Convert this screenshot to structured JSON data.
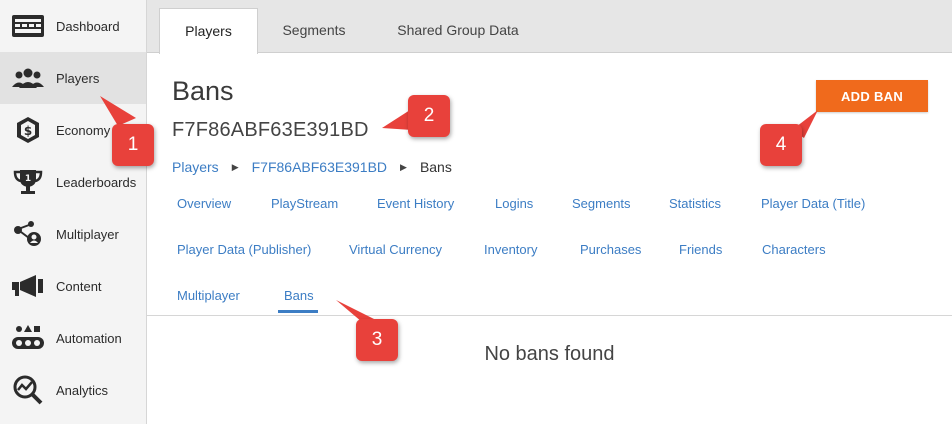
{
  "sidebar": {
    "items": [
      {
        "label": "Dashboard",
        "icon": "dashboard-icon"
      },
      {
        "label": "Players",
        "icon": "players-icon",
        "active": true
      },
      {
        "label": "Economy",
        "icon": "economy-icon"
      },
      {
        "label": "Leaderboards",
        "icon": "trophy-icon"
      },
      {
        "label": "Multiplayer",
        "icon": "multiplayer-icon"
      },
      {
        "label": "Content",
        "icon": "megaphone-icon"
      },
      {
        "label": "Automation",
        "icon": "automation-icon"
      },
      {
        "label": "Analytics",
        "icon": "analytics-icon"
      }
    ]
  },
  "top_tabs": [
    {
      "label": "Players",
      "active": true
    },
    {
      "label": "Segments"
    },
    {
      "label": "Shared Group Data"
    }
  ],
  "page": {
    "title": "Bans",
    "player_id": "F7F86ABF63E391BD",
    "add_ban_label": "ADD BAN",
    "empty_message": "No bans found"
  },
  "breadcrumb": {
    "root": "Players",
    "player": "F7F86ABF63E391BD",
    "current": "Bans"
  },
  "sub_tabs": [
    "Overview",
    "PlayStream",
    "Event History",
    "Logins",
    "Segments",
    "Statistics",
    "Player Data (Title)",
    "Player Data (Publisher)",
    "Virtual Currency",
    "Inventory",
    "Purchases",
    "Friends",
    "Characters",
    "Multiplayer",
    "Bans"
  ],
  "active_sub_tab": "Bans",
  "callouts": [
    "1",
    "2",
    "3",
    "4"
  ],
  "colors": {
    "accent_orange": "#f06a1c",
    "link_blue": "#3c7dc4",
    "callout_red": "#e8413b"
  }
}
